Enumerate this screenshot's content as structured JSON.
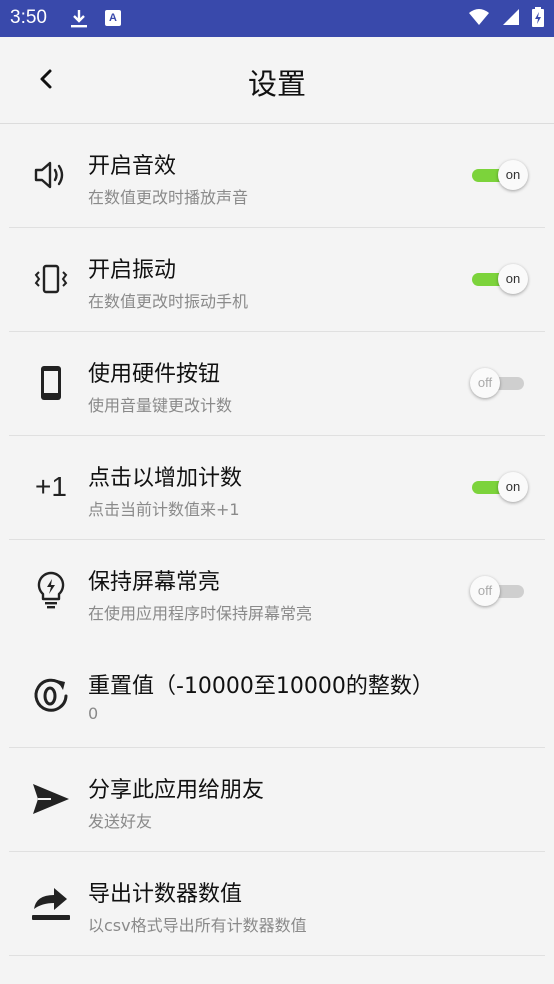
{
  "status_bar": {
    "time": "3:50",
    "notification_icons": [
      "download-icon",
      "a-letter-icon"
    ],
    "right_icons": [
      "wifi-icon",
      "signal-icon",
      "battery-charging-icon"
    ]
  },
  "toolbar": {
    "title": "设置",
    "back_icon": "back-chevron-icon"
  },
  "colors": {
    "status_bar": "#3949ab",
    "switch_on": "#7cd33b",
    "switch_off": "#cfcfcf",
    "background": "#f4f4f4"
  },
  "settings": [
    {
      "icon": "volume-icon",
      "title": "开启音效",
      "subtitle": "在数值更改时播放声音",
      "switch": "on"
    },
    {
      "icon": "vibrate-icon",
      "title": "开启振动",
      "subtitle": "在数值更改时振动手机",
      "switch": "on"
    },
    {
      "icon": "phone-icon",
      "title": "使用硬件按钮",
      "subtitle": "使用音量键更改计数",
      "switch": "off"
    },
    {
      "icon": "plus-one-icon",
      "icon_text": "+1",
      "title": "点击以增加计数",
      "subtitle": "点击当前计数值来+1",
      "switch": "on"
    },
    {
      "icon": "lightbulb-icon",
      "title": "保持屏幕常亮",
      "subtitle": "在使用应用程序时保持屏幕常亮",
      "switch": "off"
    },
    {
      "icon": "reset-zero-icon",
      "title": "重置值（-10000至10000的整数）",
      "subtitle": "0"
    },
    {
      "icon": "send-icon",
      "title": "分享此应用给朋友",
      "subtitle": "发送好友"
    },
    {
      "icon": "export-icon",
      "title": "导出计数器数值",
      "subtitle": "以csv格式导出所有计数器数值"
    }
  ]
}
